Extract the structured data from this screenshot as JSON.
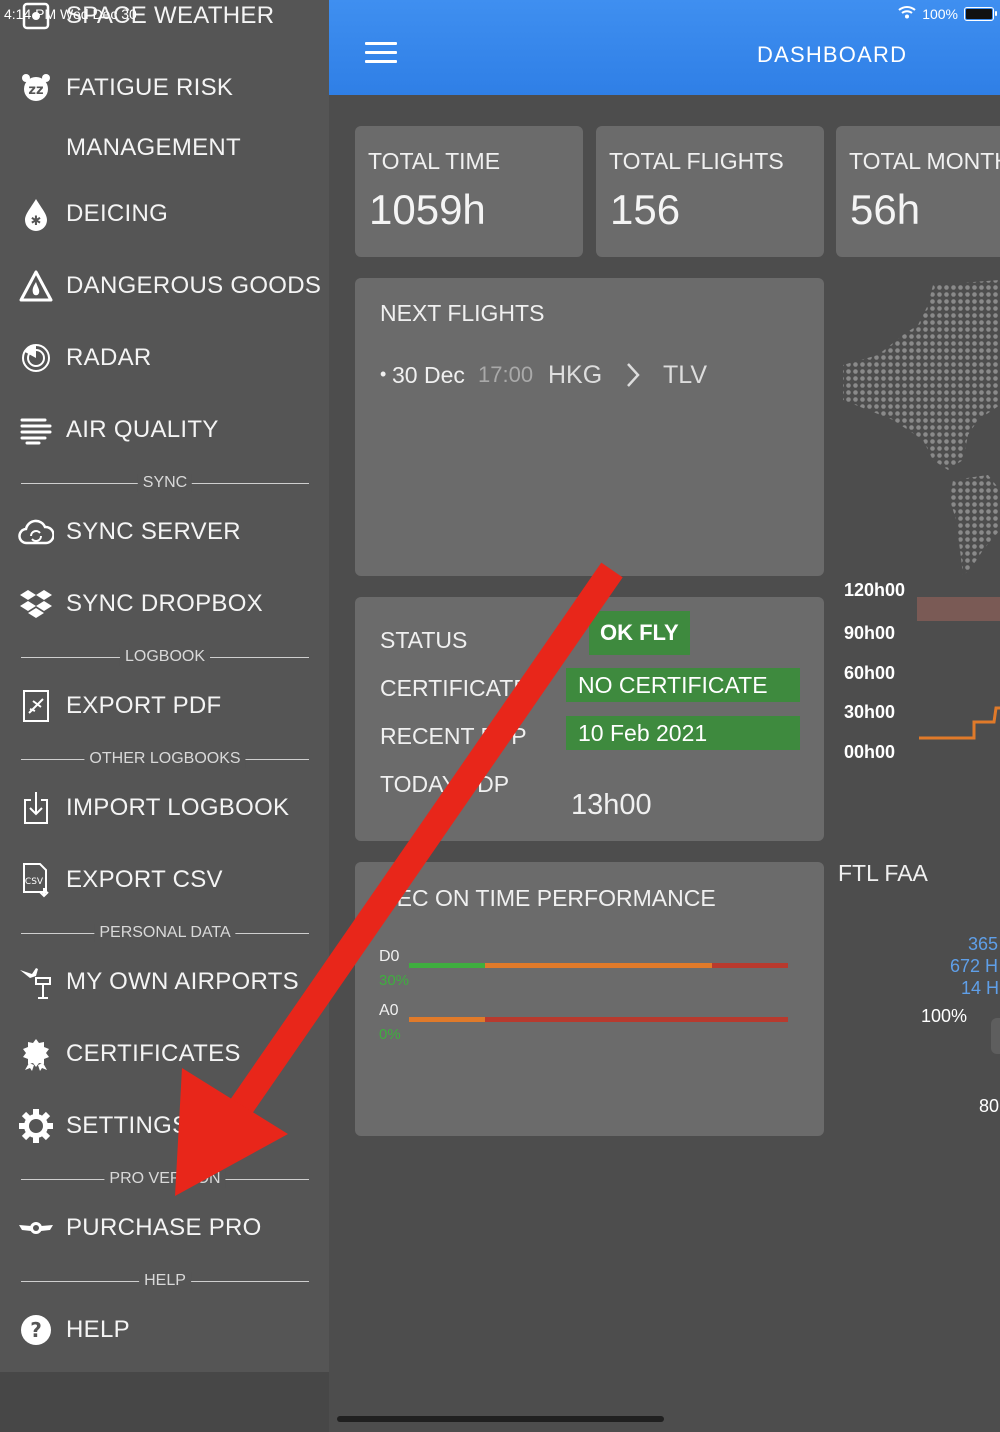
{
  "status_bar": {
    "time": "4:14 PM Wed Dec 30",
    "battery": "100%"
  },
  "sidebar": {
    "items": [
      {
        "label": "SPACE WEATHER",
        "icon": "space-weather-icon"
      },
      {
        "label": "FATIGUE RISK",
        "label2": "MANAGEMENT",
        "icon": "alarm-clock-icon"
      },
      {
        "label": "DEICING",
        "icon": "deicing-drop-icon"
      },
      {
        "label": "DANGEROUS GOODS",
        "icon": "dangerous-goods-icon"
      },
      {
        "label": "RADAR",
        "icon": "radar-icon"
      },
      {
        "label": "AIR QUALITY",
        "icon": "air-quality-icon"
      },
      {
        "label": "SYNC SERVER",
        "icon": "cloud-sync-icon"
      },
      {
        "label": "SYNC DROPBOX",
        "icon": "dropbox-icon"
      },
      {
        "label": "EXPORT PDF",
        "icon": "export-pdf-icon"
      },
      {
        "label": "IMPORT LOGBOOK",
        "icon": "import-icon"
      },
      {
        "label": "EXPORT CSV",
        "icon": "csv-file-icon"
      },
      {
        "label": "MY OWN AIRPORTS",
        "icon": "airport-tower-icon"
      },
      {
        "label": "CERTIFICATES",
        "icon": "certificate-seal-icon"
      },
      {
        "label": "SETTINGS",
        "icon": "gear-icon"
      },
      {
        "label": "PURCHASE PRO",
        "icon": "pilot-wings-icon"
      },
      {
        "label": "HELP",
        "icon": "question-icon"
      }
    ],
    "sections": {
      "sync": "SYNC",
      "logbook": "LOGBOOK",
      "other_logbooks": "OTHER LOGBOOKS",
      "personal_data": "PERSONAL DATA",
      "pro_version": "PRO VERSION",
      "help": "HELP"
    }
  },
  "header": {
    "title": "DASHBOARD"
  },
  "stats": {
    "total_time": {
      "label": "TOTAL TIME",
      "value": "1059h"
    },
    "total_flights": {
      "label": "TOTAL FLIGHTS",
      "value": "156"
    },
    "total_month": {
      "label": "TOTAL MONTH",
      "value": "56h"
    }
  },
  "next_flights": {
    "title": "NEXT FLIGHTS",
    "flights": [
      {
        "bullet": "•",
        "date": "30 Dec",
        "time": "17:00",
        "from": "HKG",
        "to": "TLV"
      }
    ]
  },
  "status_card": {
    "status_label": "STATUS",
    "status_value": "OK FLY",
    "certificate_label": "CERTIFICATE",
    "certificate_value": "NO CERTIFICATE",
    "recent_label": "RECENT FDP",
    "recent_value": "10 Feb 2021",
    "today_label": "TODAY FDP",
    "today_value": "13h00"
  },
  "otp_card": {
    "title": "DEC ON TIME PERFORMANCE",
    "rows": [
      {
        "label": "D0",
        "percent": "30%",
        "green": 0.2,
        "orange": 0.6,
        "red": 0.2
      },
      {
        "label": "A0",
        "percent": "0%",
        "green": 0,
        "orange": 0.2,
        "red": 0.8
      }
    ]
  },
  "chart": {
    "y_labels": [
      "120h00",
      "90h00",
      "60h00",
      "30h00",
      "00h00"
    ]
  },
  "ftl": {
    "title": "FTL FAA",
    "line1": "365",
    "line2": "672 H",
    "line3": "14 H",
    "percent": "100%",
    "value": "80"
  },
  "colors": {
    "accent": "#3f8ff0",
    "ok_green": "#3e8a3e",
    "arrow_red": "#e8261a",
    "bar_orange": "#e07a2a",
    "bar_red": "#b83a2e",
    "bar_green": "#3fae3f"
  }
}
